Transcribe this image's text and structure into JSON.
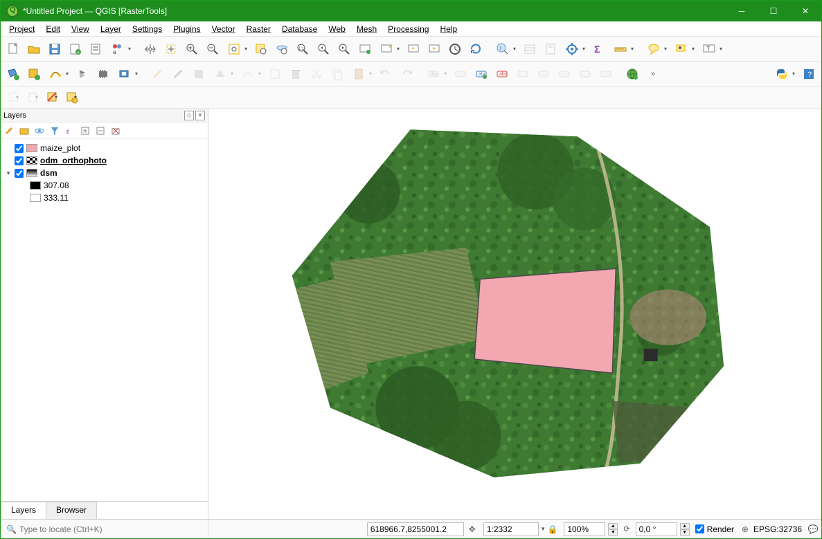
{
  "window": {
    "title": "*Untitled Project — QGIS [RasterTools]"
  },
  "menu": {
    "project": "Project",
    "edit": "Edit",
    "view": "View",
    "layer": "Layer",
    "settings": "Settings",
    "plugins": "Plugins",
    "vector": "Vector",
    "raster": "Raster",
    "database": "Database",
    "web": "Web",
    "mesh": "Mesh",
    "processing": "Processing",
    "help": "Help"
  },
  "layers_panel": {
    "title": "Layers",
    "tab_layers": "Layers",
    "tab_browser": "Browser",
    "items": [
      {
        "name": "maize_plot",
        "color": "#f2a7b1",
        "checked": true,
        "bold": false
      },
      {
        "name": "odm_orthophoto",
        "checked": true,
        "bold": true,
        "underline": true
      },
      {
        "name": "dsm",
        "checked": true,
        "bold": true,
        "children": [
          {
            "label": "307.08",
            "swatch": "#000000"
          },
          {
            "label": "333.11",
            "swatch": "#ffffff"
          }
        ]
      }
    ]
  },
  "statusbar": {
    "locate_placeholder": "Type to locate (Ctrl+K)",
    "coord": "618966.7,8255001.2",
    "scale": "1:2332",
    "magnifier": "100%",
    "rotation": "0,0 °",
    "render_label": "Render",
    "crs": "EPSG:32736"
  },
  "colors": {
    "titlebar": "#1d8e1d",
    "maize_fill": "#f2a7b1"
  }
}
